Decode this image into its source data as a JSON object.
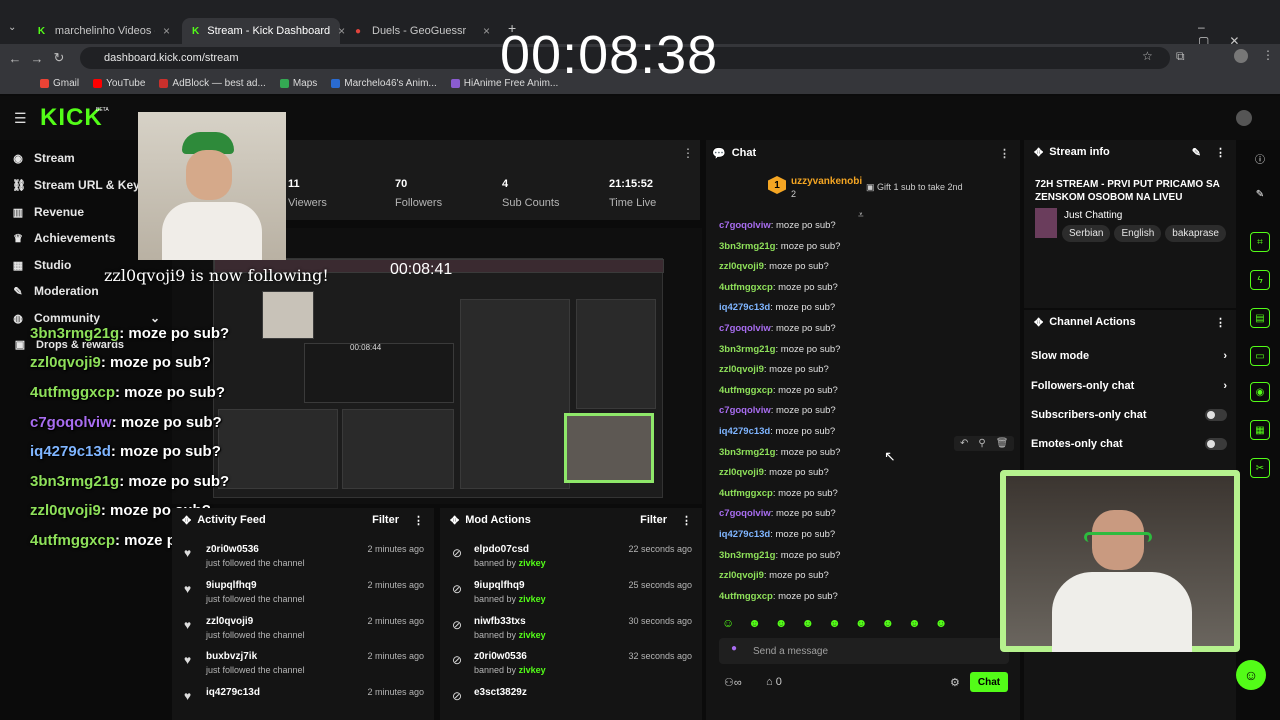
{
  "browser": {
    "tabs": [
      {
        "title": "marchelinho Videos - Watch Clip",
        "icon": "kick-icon"
      },
      {
        "title": "Stream - Kick Dashboard",
        "icon": "kick-icon"
      },
      {
        "title": "Duels - GeoGuessr",
        "icon": "geoguessr-icon"
      }
    ],
    "new_tab": "+",
    "url": "dashboard.kick.com/stream",
    "bookmarks": [
      "Gmail",
      "YouTube",
      "AdBlock — best ad...",
      "Maps",
      "Marchelo46's Anim...",
      "HiAnime Free Anim..."
    ]
  },
  "overlay": {
    "timer": "00:08:38",
    "follow_alert": "zzl0qvoji9 is now following!",
    "messages": [
      {
        "user": "3bn3rmg21g",
        "text": ": moze po sub?",
        "color": "#8ee05a"
      },
      {
        "user": "zzl0qvoji9",
        "text": ": moze po sub?",
        "color": "#8ee05a"
      },
      {
        "user": "4utfmggxcp",
        "text": ": moze po sub?",
        "color": "#8ee05a"
      },
      {
        "user": "c7goqolviw",
        "text": ": moze po sub?",
        "color": "#a86df0"
      },
      {
        "user": "iq4279c13d",
        "text": ": moze po sub?",
        "color": "#7fb5ff"
      },
      {
        "user": "3bn3rmg21g",
        "text": ": moze po sub?",
        "color": "#8ee05a"
      },
      {
        "user": "zzl0qvoji9",
        "text": ": moze po sub?",
        "color": "#8ee05a"
      },
      {
        "user": "4utfmggxcp",
        "text": ": moze po sub?",
        "color": "#8ee05a"
      }
    ],
    "preview_timer": "00:08:41",
    "preview_inner_timer": "00:08:44"
  },
  "kick": {
    "logo": "KICK",
    "beta": "BETA",
    "sidebar": [
      {
        "label": "Stream",
        "icon": "broadcast-icon"
      },
      {
        "label": "Stream URL & Key",
        "icon": "link-icon"
      },
      {
        "label": "Revenue",
        "icon": "chart-icon"
      },
      {
        "label": "Achievements",
        "icon": "trophy-icon"
      },
      {
        "label": "Studio",
        "icon": "grid-icon"
      },
      {
        "label": "Moderation",
        "icon": "wrench-icon"
      },
      {
        "label": "Community",
        "icon": "globe-icon"
      },
      {
        "label": "Drops & rewards",
        "icon": "gift-icon"
      }
    ],
    "stats": [
      {
        "value": "11",
        "label": "Viewers"
      },
      {
        "value": "70",
        "label": "Followers"
      },
      {
        "value": "4",
        "label": "Sub Counts"
      },
      {
        "value": "21:15:52",
        "label": "Time Live"
      }
    ],
    "activity": {
      "title": "Activity Feed",
      "filter": "Filter",
      "items": [
        {
          "name": "z0ri0w0536",
          "sub": "just followed the channel",
          "time": "2 minutes ago"
        },
        {
          "name": "9iupqlfhq9",
          "sub": "just followed the channel",
          "time": "2 minutes ago"
        },
        {
          "name": "zzl0qvoji9",
          "sub": "just followed the channel",
          "time": "2 minutes ago"
        },
        {
          "name": "buxbvzj7ik",
          "sub": "just followed the channel",
          "time": "2 minutes ago"
        },
        {
          "name": "iq4279c13d",
          "sub": "",
          "time": "2 minutes ago"
        }
      ]
    },
    "mod": {
      "title": "Mod Actions",
      "filter": "Filter",
      "items": [
        {
          "name": "elpdo07csd",
          "by": "banned by",
          "mod": "zivkey",
          "time": "22 seconds ago"
        },
        {
          "name": "9iupqlfhq9",
          "by": "banned by",
          "mod": "zivkey",
          "time": "25 seconds ago"
        },
        {
          "name": "niwfb33txs",
          "by": "banned by",
          "mod": "zivkey",
          "time": "30 seconds ago"
        },
        {
          "name": "z0ri0w0536",
          "by": "banned by",
          "mod": "zivkey",
          "time": "32 seconds ago"
        },
        {
          "name": "e3sct3829z",
          "by": "",
          "mod": "",
          "time": ""
        }
      ]
    },
    "chat": {
      "title": "Chat",
      "pinned_badge": "1",
      "pinned_user": "uzzyvankenobi",
      "pinned_count": "2",
      "gift_text": "Gift 1 sub to take 2nd",
      "messages": [
        {
          "user": "c7goqolviw",
          "text": ": moze po sub?",
          "color": "#a86df0"
        },
        {
          "user": "3bn3rmg21g",
          "text": ": moze po sub?",
          "color": "#8ee05a"
        },
        {
          "user": "zzl0qvoji9",
          "text": ": moze po sub?",
          "color": "#8ee05a"
        },
        {
          "user": "4utfmggxcp",
          "text": ": moze po sub?",
          "color": "#8ee05a"
        },
        {
          "user": "iq4279c13d",
          "text": ": moze po sub?",
          "color": "#7fb5ff"
        },
        {
          "user": "c7goqolviw",
          "text": ": moze po sub?",
          "color": "#a86df0"
        },
        {
          "user": "3bn3rmg21g",
          "text": ": moze po sub?",
          "color": "#8ee05a"
        },
        {
          "user": "zzl0qvoji9",
          "text": ": moze po sub?",
          "color": "#8ee05a"
        },
        {
          "user": "4utfmggxcp",
          "text": ": moze po sub?",
          "color": "#8ee05a"
        },
        {
          "user": "c7goqolviw",
          "text": ": moze po sub?",
          "color": "#a86df0"
        },
        {
          "user": "iq4279c13d",
          "text": ": moze po sub?",
          "color": "#7fb5ff"
        },
        {
          "user": "3bn3rmg21g",
          "text": ": moze po sub?",
          "color": "#8ee05a"
        },
        {
          "user": "zzl0qvoji9",
          "text": ": moze po sub?",
          "color": "#8ee05a"
        },
        {
          "user": "4utfmggxcp",
          "text": ": moze po sub?",
          "color": "#8ee05a"
        },
        {
          "user": "c7goqolviw",
          "text": ": moze po sub?",
          "color": "#a86df0"
        },
        {
          "user": "iq4279c13d",
          "text": ": moze po sub?",
          "color": "#7fb5ff"
        },
        {
          "user": "3bn3rmg21g",
          "text": ": moze po sub?",
          "color": "#8ee05a"
        },
        {
          "user": "zzl0qvoji9",
          "text": ": moze po sub?",
          "color": "#8ee05a"
        },
        {
          "user": "4utfmggxcp",
          "text": ": moze po sub?",
          "color": "#8ee05a"
        }
      ],
      "placeholder": "Send a message",
      "count": "0",
      "send_label": "Chat"
    },
    "stream_info": {
      "title": "Stream info",
      "stream_title": "72H STREAM - PRVI PUT PRICAMO SA ZENSKOM OSOBOM NA LIVEU",
      "category": "Just Chatting",
      "tags": [
        "Serbian",
        "English",
        "bakaprase"
      ]
    },
    "channel_actions": {
      "title": "Channel Actions",
      "items": [
        {
          "label": "Slow mode",
          "control": "arrow"
        },
        {
          "label": "Followers-only chat",
          "control": "arrow"
        },
        {
          "label": "Subscribers-only chat",
          "control": "toggle"
        },
        {
          "label": "Emotes-only chat",
          "control": "toggle"
        }
      ]
    },
    "accent": "#53fc18"
  }
}
